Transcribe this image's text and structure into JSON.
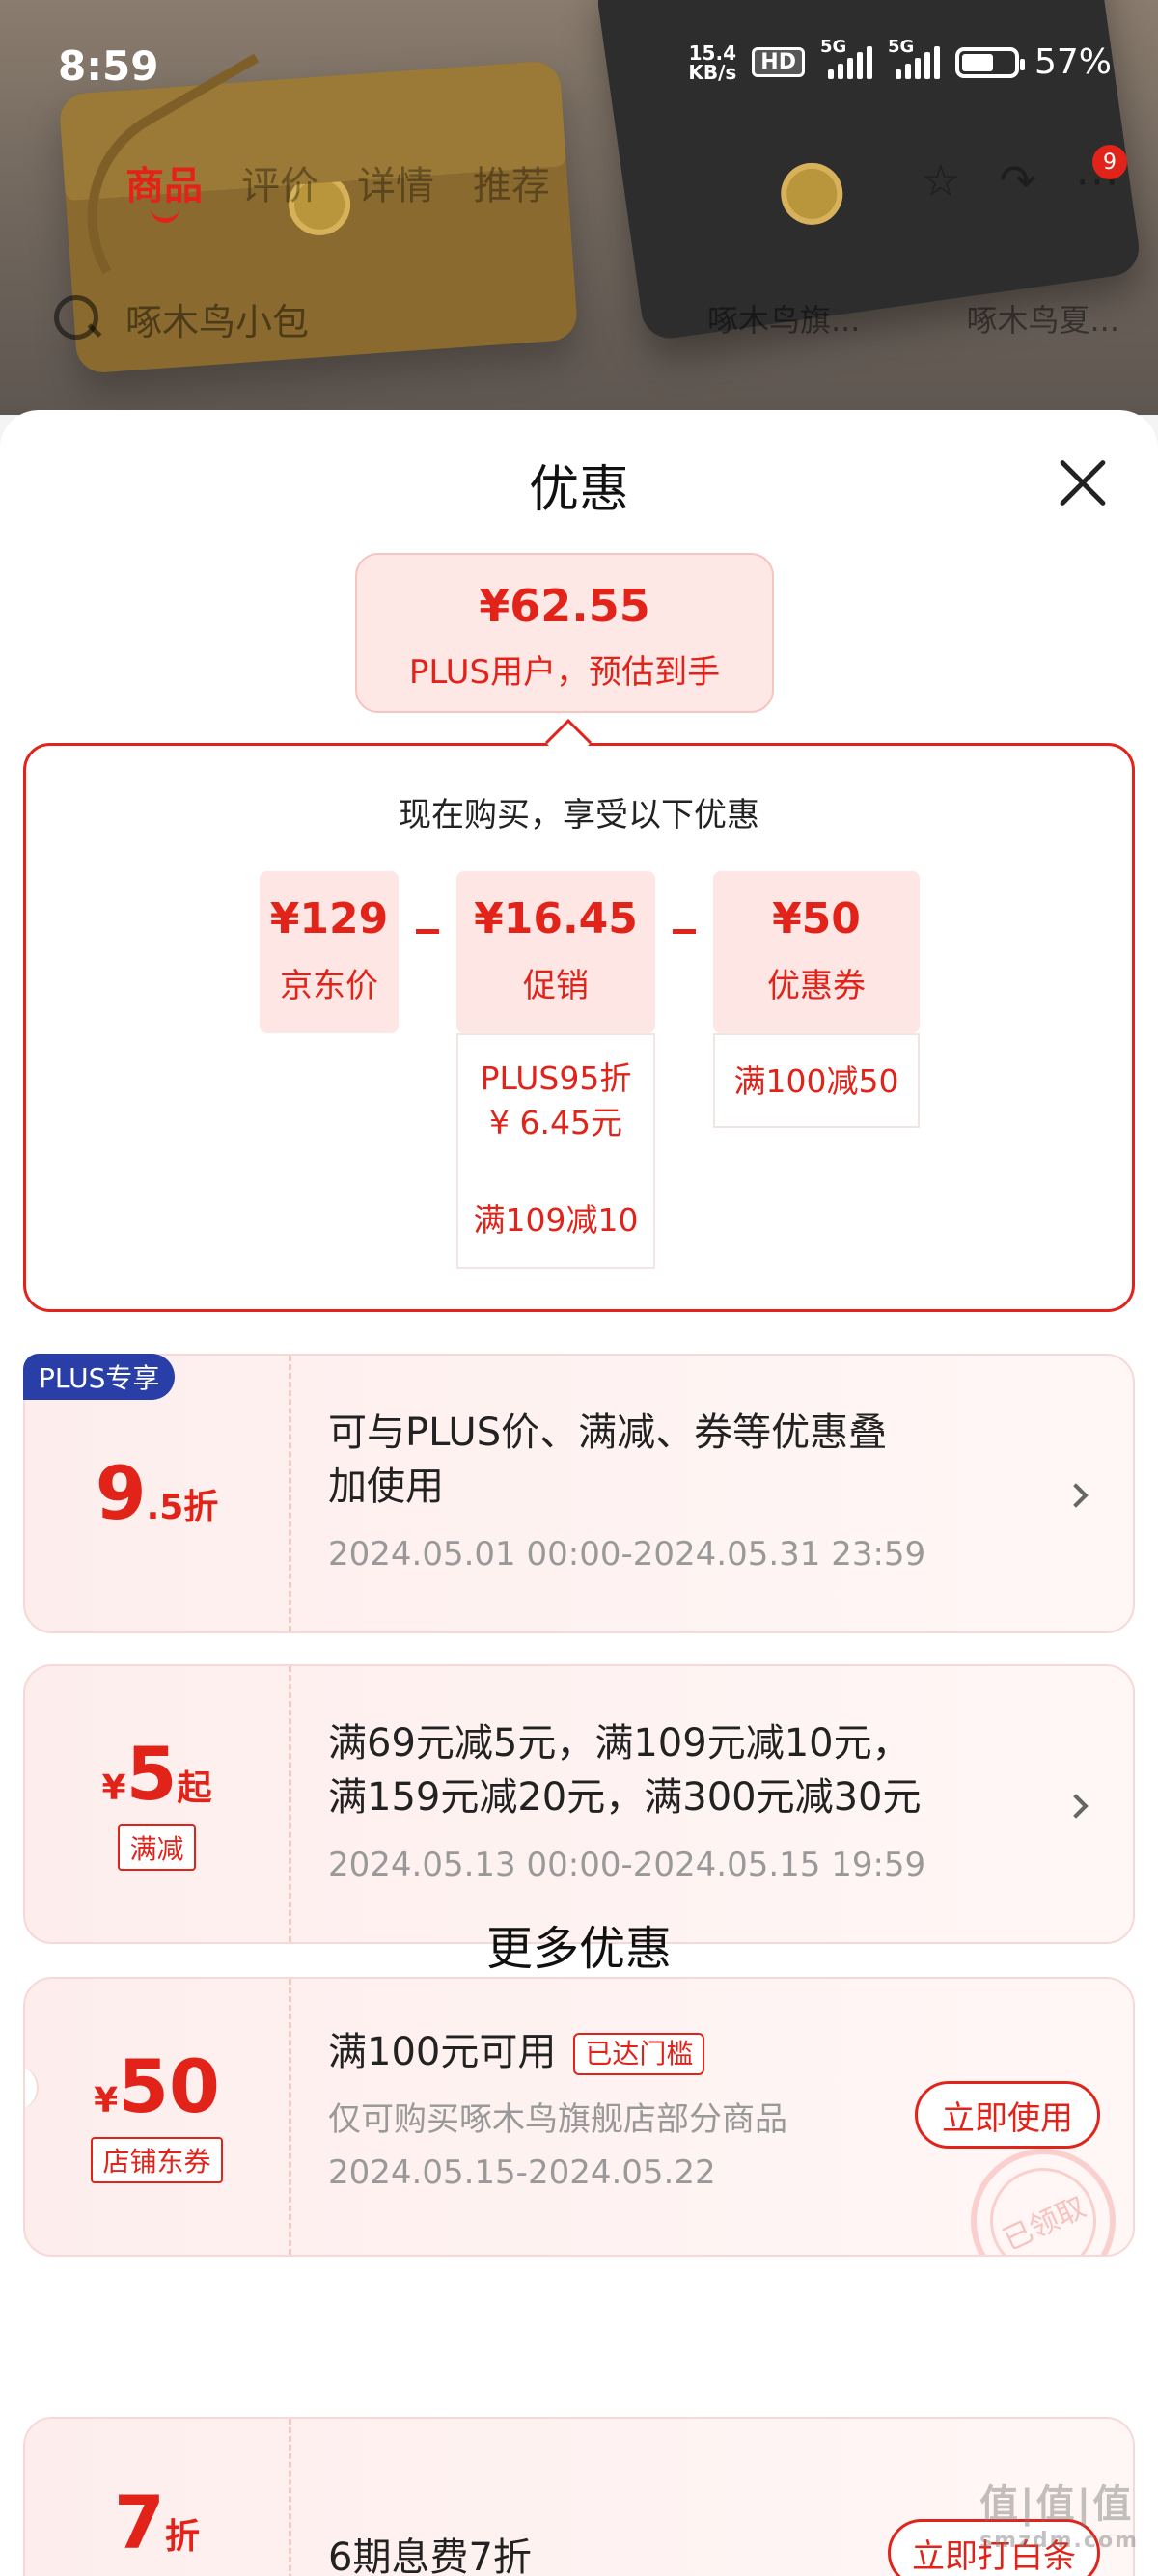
{
  "status_bar": {
    "time": "8:59",
    "net_speed_value": "15.4",
    "net_speed_unit": "KB/s",
    "hd": "HD",
    "signal_1": "5G",
    "signal_2": "5G",
    "battery": "57%"
  },
  "product_nav": {
    "tabs": [
      "商品",
      "评价",
      "详情",
      "推荐"
    ],
    "cart_count": "9"
  },
  "search": {
    "query": "啄木鸟小包",
    "tags": [
      "啄木鸟旗...",
      "啄木鸟夏..."
    ]
  },
  "sheet": {
    "title": "优惠",
    "final_price": {
      "amount": "¥62.55",
      "label": "PLUS用户，预估到手"
    },
    "breakdown": {
      "heading": "现在购买，享受以下优惠",
      "jd_price": {
        "amount": "¥129",
        "label": "京东价"
      },
      "promo": {
        "amount": "¥16.45",
        "label": "促销",
        "items": [
          "PLUS95折",
          "¥ 6.45元",
          "满109减10"
        ]
      },
      "coupon": {
        "amount": "¥50",
        "label": "优惠券",
        "items": [
          "满100减50"
        ]
      }
    },
    "cards": [
      {
        "badge": "PLUS专享",
        "value_big": "9",
        "value_small": ".5折",
        "line1": "可与PLUS价、满减、券等优惠叠",
        "line2": "加使用",
        "period": "2024.05.01 00:00-2024.05.31 23:59"
      },
      {
        "currency": "¥",
        "value_big": "5",
        "suffix": "起",
        "tag": "满减",
        "line1": "满69元减5元，满109元减10元，",
        "line2": "满159元减20元，满300元减30元",
        "period": "2024.05.13 00:00-2024.05.15 19:59"
      },
      {
        "currency": "¥",
        "value_big": "50",
        "tag": "店铺东券",
        "line1": "满100元可用",
        "reached": "已达门槛",
        "line2": "仅可购买啄木鸟旗舰店部分商品",
        "period": "2024.05.15-2024.05.22",
        "button": "立即使用",
        "stamp": "已领取"
      }
    ],
    "more_title": "更多优惠",
    "more_card": {
      "value_big": "7",
      "suffix": "折",
      "line1": "6期息费7折",
      "button": "立即打白条"
    },
    "watermark": {
      "text": "值|值|值",
      "sub": "smzdm.com"
    }
  }
}
